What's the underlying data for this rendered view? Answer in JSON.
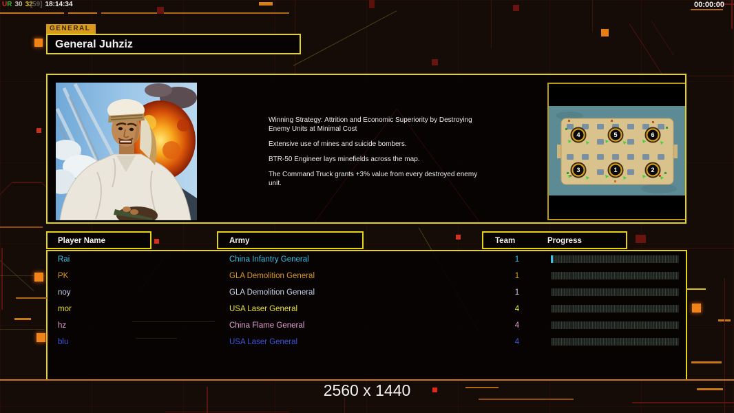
{
  "overlay": {
    "u": "U",
    "r": "R",
    "fps_a": "30",
    "fps_b": "32",
    "fps_c": "[59]",
    "clock": "18:14:34",
    "timer": "00:00:00"
  },
  "general": {
    "tab": "GENERAL",
    "name": "General Juhziz"
  },
  "strategy": {
    "p1": "Winning Strategy: Attrition and Economic Superiority by Destroying\n Enemy Units at Minimal Cost",
    "p2": "Extensive use of mines and suicide bombers.",
    "p3": "BTR-50 Engineer lays minefields across the map.",
    "p4": "The Command Truck grants +3% value from every destroyed enemy\n unit."
  },
  "map": {
    "start_positions": [
      {
        "label": "4",
        "col": 0,
        "row": 0
      },
      {
        "label": "5",
        "col": 1,
        "row": 0
      },
      {
        "label": "6",
        "col": 2,
        "row": 0
      },
      {
        "label": "3",
        "col": 0,
        "row": 1
      },
      {
        "label": "1",
        "col": 1,
        "row": 1
      },
      {
        "label": "2",
        "col": 2,
        "row": 1
      }
    ]
  },
  "table": {
    "headers": {
      "player": "Player Name",
      "army": "Army",
      "team": "Team",
      "progress": "Progress"
    },
    "rows": [
      {
        "name": "Rai",
        "army": "China Infantry General",
        "team": "1",
        "color": "#3ec1e8",
        "progress_cells": 1
      },
      {
        "name": "PK",
        "army": "GLA Demolition General",
        "team": "1",
        "color": "#d9991f",
        "progress_cells": 0
      },
      {
        "name": "noy",
        "army": "GLA Demolition General",
        "team": "1",
        "color": "#c9cfe9",
        "progress_cells": 0
      },
      {
        "name": "mor",
        "army": "USA Laser General",
        "team": "4",
        "color": "#e6e23a",
        "progress_cells": 0
      },
      {
        "name": "hz",
        "army": "China Flame General",
        "team": "4",
        "color": "#dfa3d2",
        "progress_cells": 0
      },
      {
        "name": "blu",
        "army": "USA Laser General",
        "team": "4",
        "color": "#3d55e0",
        "progress_cells": 0
      }
    ],
    "progress_total_cells": 46
  },
  "footer": {
    "resolution": "2560 x 1440"
  },
  "colors": {
    "box_border": "#e4d316",
    "accent_orange": "#c87818",
    "bright_square": "#f08418",
    "red_square": "#d83020",
    "bar_empty": "#1d221d",
    "bar_grid": "#39403a"
  }
}
